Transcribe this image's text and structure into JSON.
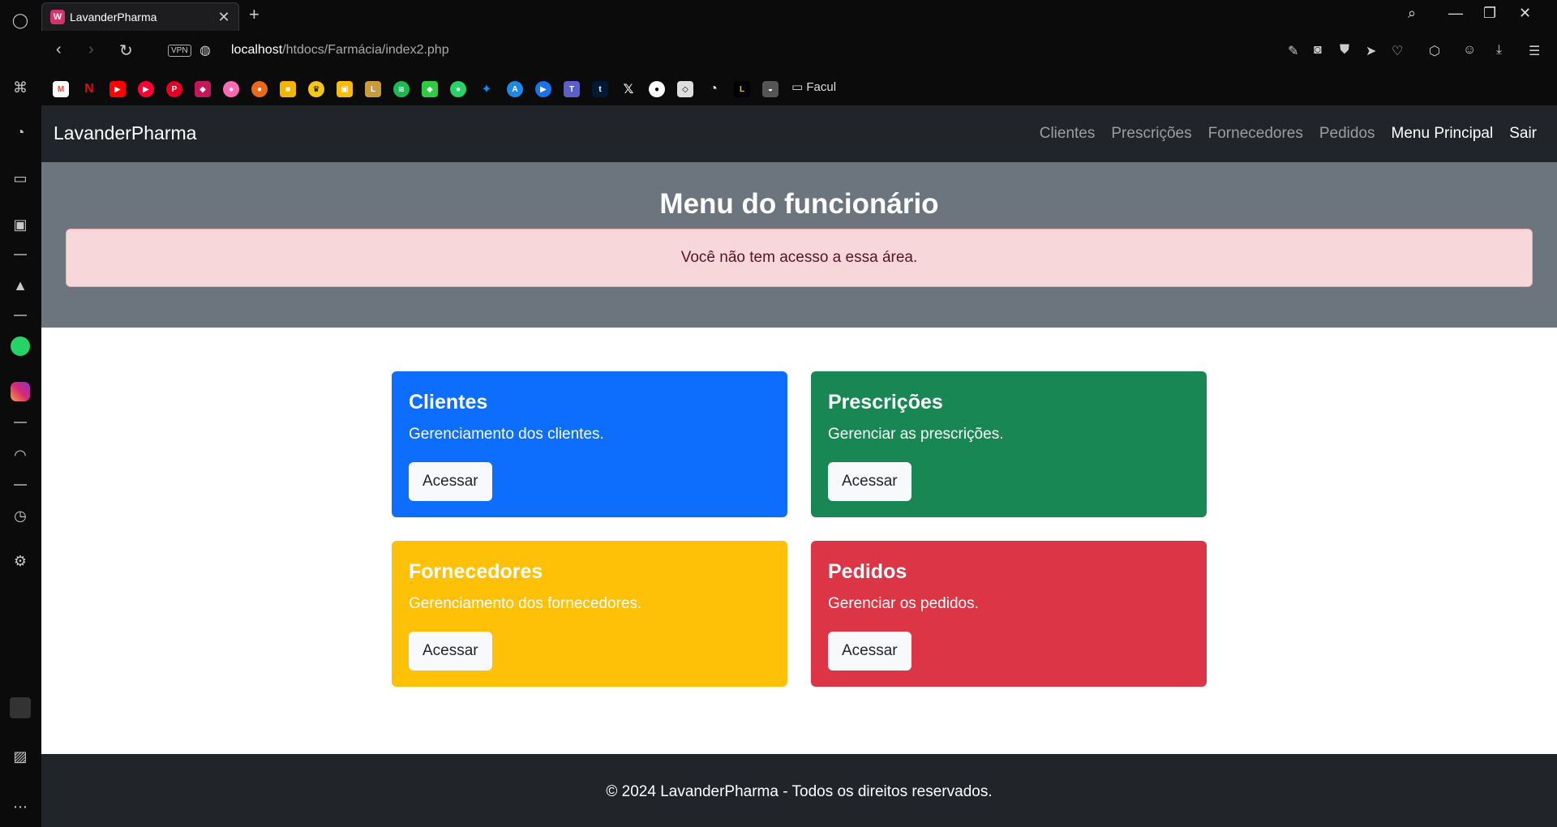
{
  "browser": {
    "tab_title": "LavanderPharma",
    "tab_favicon": "W",
    "new_tab": "+",
    "url_host": "localhost",
    "url_path": "/htdocs/Farmácia/index2.php",
    "vpn": "VPN",
    "bookmark_folder": "Facul"
  },
  "site": {
    "brand": "LavanderPharma",
    "nav": [
      "Clientes",
      "Prescrições",
      "Fornecedores",
      "Pedidos",
      "Menu Principal",
      "Sair"
    ],
    "hero_title": "Menu do funcionário",
    "alert": "Você não tem acesso a essa área.",
    "cards": [
      {
        "title": "Clientes",
        "text": "Gerenciamento dos clientes.",
        "button": "Acessar",
        "color": "#0d6efd"
      },
      {
        "title": "Prescrições",
        "text": "Gerenciar as prescrições.",
        "button": "Acessar",
        "color": "#198754"
      },
      {
        "title": "Fornecedores",
        "text": "Gerenciamento dos fornecedores.",
        "button": "Acessar",
        "color": "#ffc107"
      },
      {
        "title": "Pedidos",
        "text": "Gerenciar os pedidos.",
        "button": "Acessar",
        "color": "#dc3545"
      }
    ],
    "footer": "© 2024 LavanderPharma - Todos os direitos reservados."
  }
}
